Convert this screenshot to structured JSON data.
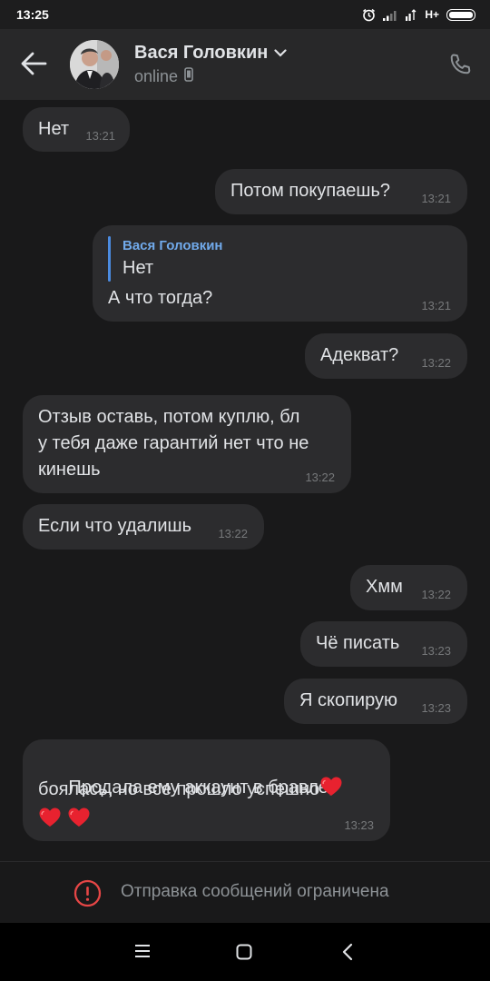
{
  "status_bar": {
    "time": "13:25",
    "network": "H+"
  },
  "header": {
    "contact_name": "Вася Головкин",
    "status": "online"
  },
  "messages": [
    {
      "direction": "in",
      "text": "Нет",
      "time": "13:21"
    },
    {
      "direction": "out",
      "text": "Потом покупаешь?",
      "time": "13:21"
    },
    {
      "direction": "out",
      "reply_author": "Вася Головкин",
      "reply_text": "Нет",
      "text": "А что тогда?",
      "time": "13:21"
    },
    {
      "direction": "out",
      "text": "Адекват?",
      "time": "13:22"
    },
    {
      "direction": "in",
      "text": "Отзыв оставь, потом куплю, бл\nу тебя даже гарантий нет что не\nкинешь",
      "time": "13:22"
    },
    {
      "direction": "in",
      "text": "Если что удалишь",
      "time": "13:22"
    },
    {
      "direction": "out",
      "text": "Хмм",
      "time": "13:22"
    },
    {
      "direction": "out",
      "text": "Чё писать",
      "time": "13:23"
    },
    {
      "direction": "out",
      "text": "Я скопирую",
      "time": "13:23"
    },
    {
      "direction": "in",
      "text_line1": "Продала ему аккаунт в бравле,",
      "text_line2": "боялась, но все прошло успешно",
      "time": "13:23"
    }
  ],
  "restriction": {
    "text": "Отправка сообщений ограничена"
  },
  "colors": {
    "background": "#19191a",
    "bubble": "#2c2c2e",
    "accent": "#71aaeb",
    "warning": "#e64646",
    "heart": "#e8222f"
  }
}
